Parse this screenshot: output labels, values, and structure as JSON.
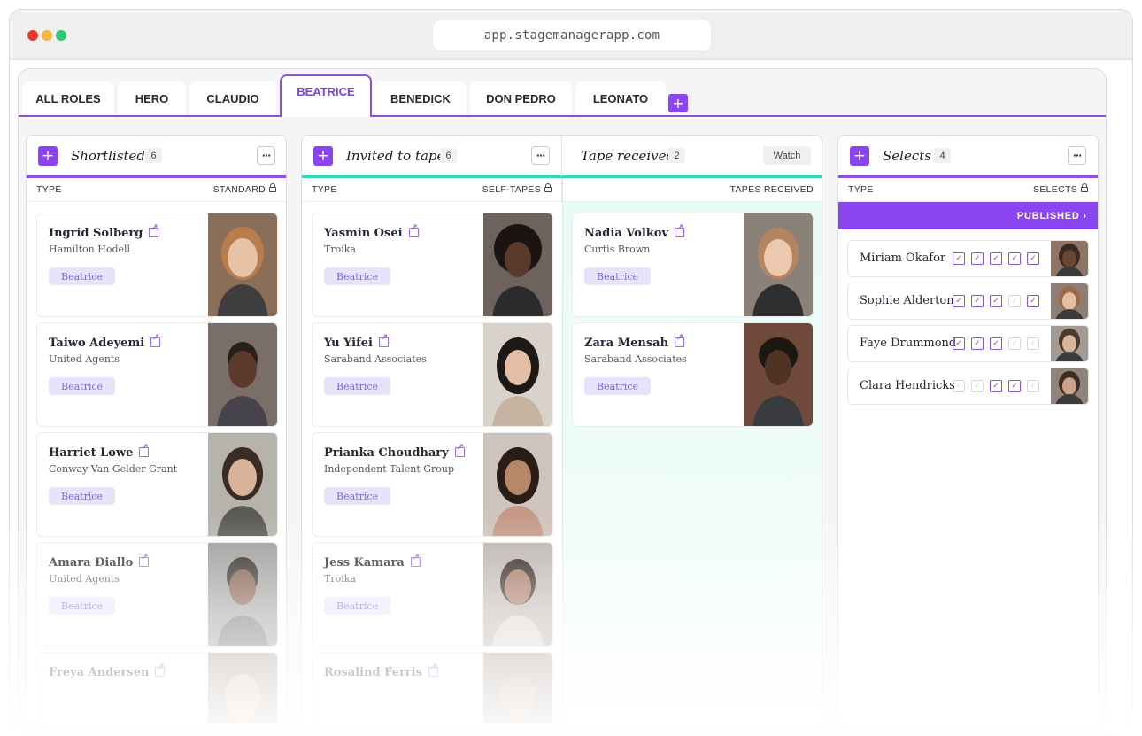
{
  "browser": {
    "url": "app.stagemanagerapp.com"
  },
  "tabs": [
    {
      "label": "ALL ROLES",
      "active": false
    },
    {
      "label": "HERO",
      "active": false
    },
    {
      "label": "CLAUDIO",
      "active": false
    },
    {
      "label": "BEATRICE",
      "active": true
    },
    {
      "label": "BENEDICK",
      "active": false
    },
    {
      "label": "DON PEDRO",
      "active": false
    },
    {
      "label": "LEONATO",
      "active": false
    }
  ],
  "add_symbol": "+",
  "more_symbol": "···",
  "columns": {
    "shortlisted": {
      "title": "Shortlisted",
      "count": "6",
      "type_label": "TYPE",
      "mode_label": "STANDARD",
      "cards": [
        {
          "name": "Ingrid Solberg",
          "agency": "Hamilton Hodell",
          "role": "Beatrice"
        },
        {
          "name": "Taiwo Adeyemi",
          "agency": "United Agents",
          "role": "Beatrice"
        },
        {
          "name": "Harriet Lowe",
          "agency": "Conway Van Gelder Grant",
          "role": "Beatrice"
        },
        {
          "name": "Amara Diallo",
          "agency": "United Agents",
          "role": "Beatrice"
        },
        {
          "name": "Freya Andersen",
          "agency": "",
          "role": ""
        }
      ]
    },
    "invited": {
      "title": "Invited to tape",
      "count": "6",
      "type_label": "TYPE",
      "mode_label": "SELF-TAPES",
      "cards": [
        {
          "name": "Yasmin Osei",
          "agency": "Troika",
          "role": "Beatrice"
        },
        {
          "name": "Yu Yifei",
          "agency": "Saraband Associates",
          "role": "Beatrice"
        },
        {
          "name": "Prianka Choudhary",
          "agency": "Independent Talent Group",
          "role": "Beatrice"
        },
        {
          "name": "Jess Kamara",
          "agency": "Troika",
          "role": "Beatrice"
        },
        {
          "name": "Rosalind Ferris",
          "agency": "",
          "role": ""
        }
      ]
    },
    "tape_received": {
      "title": "Tape received",
      "count": "2",
      "watch_label": "Watch",
      "mode_label": "TAPES RECEIVED",
      "cards": [
        {
          "name": "Nadia Volkov",
          "agency": "Curtis Brown",
          "role": "Beatrice"
        },
        {
          "name": "Zara Mensah",
          "agency": "Saraband Associates",
          "role": "Beatrice"
        }
      ]
    },
    "selects": {
      "title": "Selects",
      "count": "4",
      "type_label": "TYPE",
      "mode_label": "SELECTS",
      "published_label": "PUBLISHED ›",
      "rows": [
        {
          "name": "Miriam Okafor",
          "checks": [
            true,
            true,
            true,
            true,
            true
          ]
        },
        {
          "name": "Sophie Alderton",
          "checks": [
            true,
            true,
            true,
            false,
            true
          ]
        },
        {
          "name": "Faye Drummond",
          "checks": [
            true,
            true,
            true,
            false,
            false
          ]
        },
        {
          "name": "Clara Hendricks",
          "checks": [
            false,
            false,
            true,
            true,
            false
          ]
        }
      ]
    }
  },
  "colors": {
    "accent": "#8b45f0",
    "teal": "#2fd6b8",
    "tag_bg": "#e6e4fb"
  },
  "icons": {
    "external_link": "external-link-icon",
    "lock": "lock-icon",
    "check": "✓"
  }
}
